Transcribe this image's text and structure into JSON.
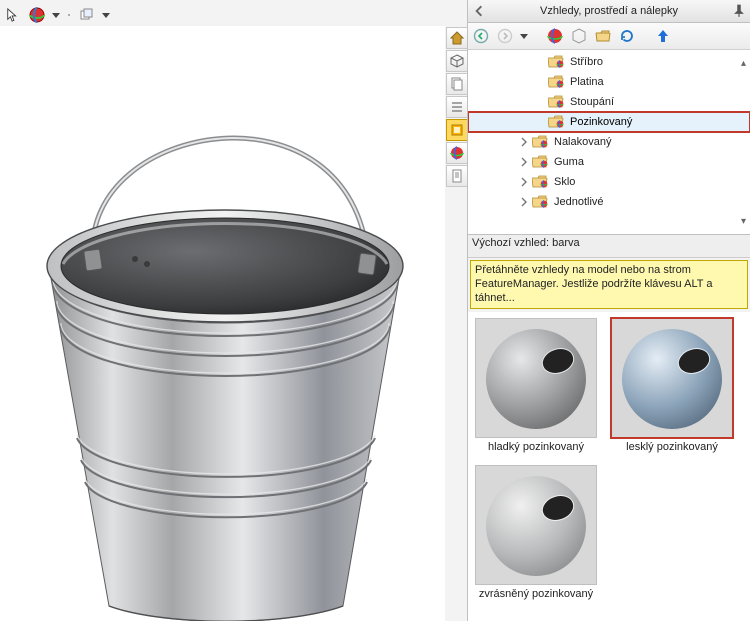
{
  "panel": {
    "title": "Vzhledy, prostředí a nálepky",
    "default_label": "Výchozí vzhled: barva",
    "hint_line1": "Přetáhněte vzhledy na model nebo na strom",
    "hint_line2": "FeatureManager. Jestliže podržíte klávesu ALT a táhnet..."
  },
  "tree": {
    "items": [
      {
        "label": "Stříbro",
        "indent": 66,
        "expander": "none",
        "selected": false
      },
      {
        "label": "Platina",
        "indent": 66,
        "expander": "none",
        "selected": false
      },
      {
        "label": "Stoupání",
        "indent": 66,
        "expander": "none",
        "selected": false
      },
      {
        "label": "Pozinkovaný",
        "indent": 66,
        "expander": "none",
        "selected": true,
        "framed": true
      },
      {
        "label": "Nalakovaný",
        "indent": 50,
        "expander": "closed",
        "selected": false
      },
      {
        "label": "Guma",
        "indent": 50,
        "expander": "closed",
        "selected": false
      },
      {
        "label": "Sklo",
        "indent": 50,
        "expander": "closed",
        "selected": false
      },
      {
        "label": "Jednotlivé",
        "indent": 50,
        "expander": "closed",
        "selected": false
      }
    ]
  },
  "previews": [
    {
      "label": "hladký pozinkovaný",
      "selected": false,
      "tone": "gray"
    },
    {
      "label": "lesklý pozinkovaný",
      "selected": true,
      "tone": "blue"
    },
    {
      "label": "zvrásněný pozinkovaný",
      "selected": false,
      "tone": "lightgray"
    }
  ]
}
